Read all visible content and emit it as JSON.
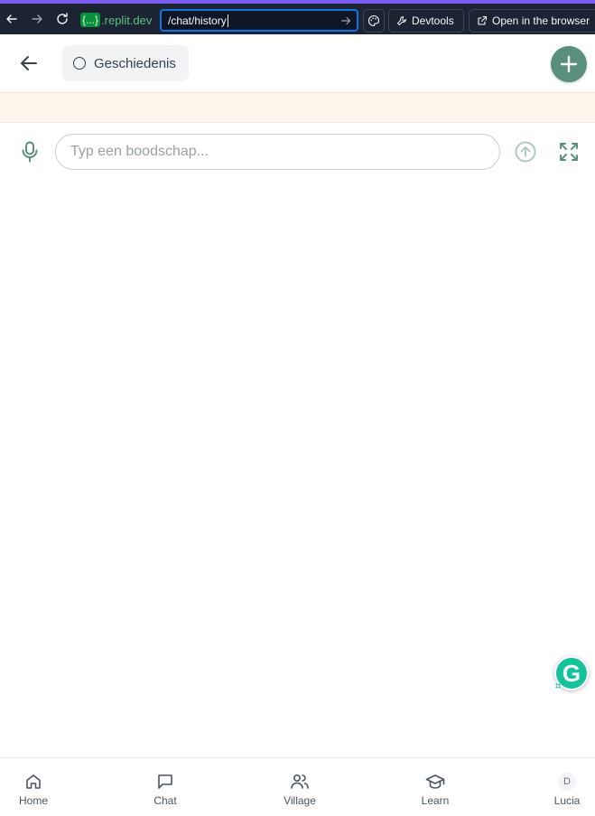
{
  "browser": {
    "domain_tag": "{...}",
    "domain_suffix": ".replit.dev",
    "url_path": "/chat/history",
    "devtools_label": "Devtools",
    "open_browser_label": "Open in the browser"
  },
  "header": {
    "history_label": "Geschiedenis"
  },
  "composer": {
    "placeholder": "Typ een boodschap..."
  },
  "bottom_nav": {
    "items": [
      {
        "label": "Home",
        "icon": "home-icon"
      },
      {
        "label": "Chat",
        "icon": "chat-icon"
      },
      {
        "label": "Village",
        "icon": "users-icon"
      },
      {
        "label": "Learn",
        "icon": "graduation-cap-icon"
      },
      {
        "label": "Lucia",
        "avatar_initial": "D"
      }
    ]
  },
  "grammarly": {
    "letter": "G"
  },
  "colors": {
    "accent": "#5a8f7b",
    "chrome_bg": "#1c2333",
    "banner": "#fff6ee",
    "url_focus": "#0b75e6"
  }
}
